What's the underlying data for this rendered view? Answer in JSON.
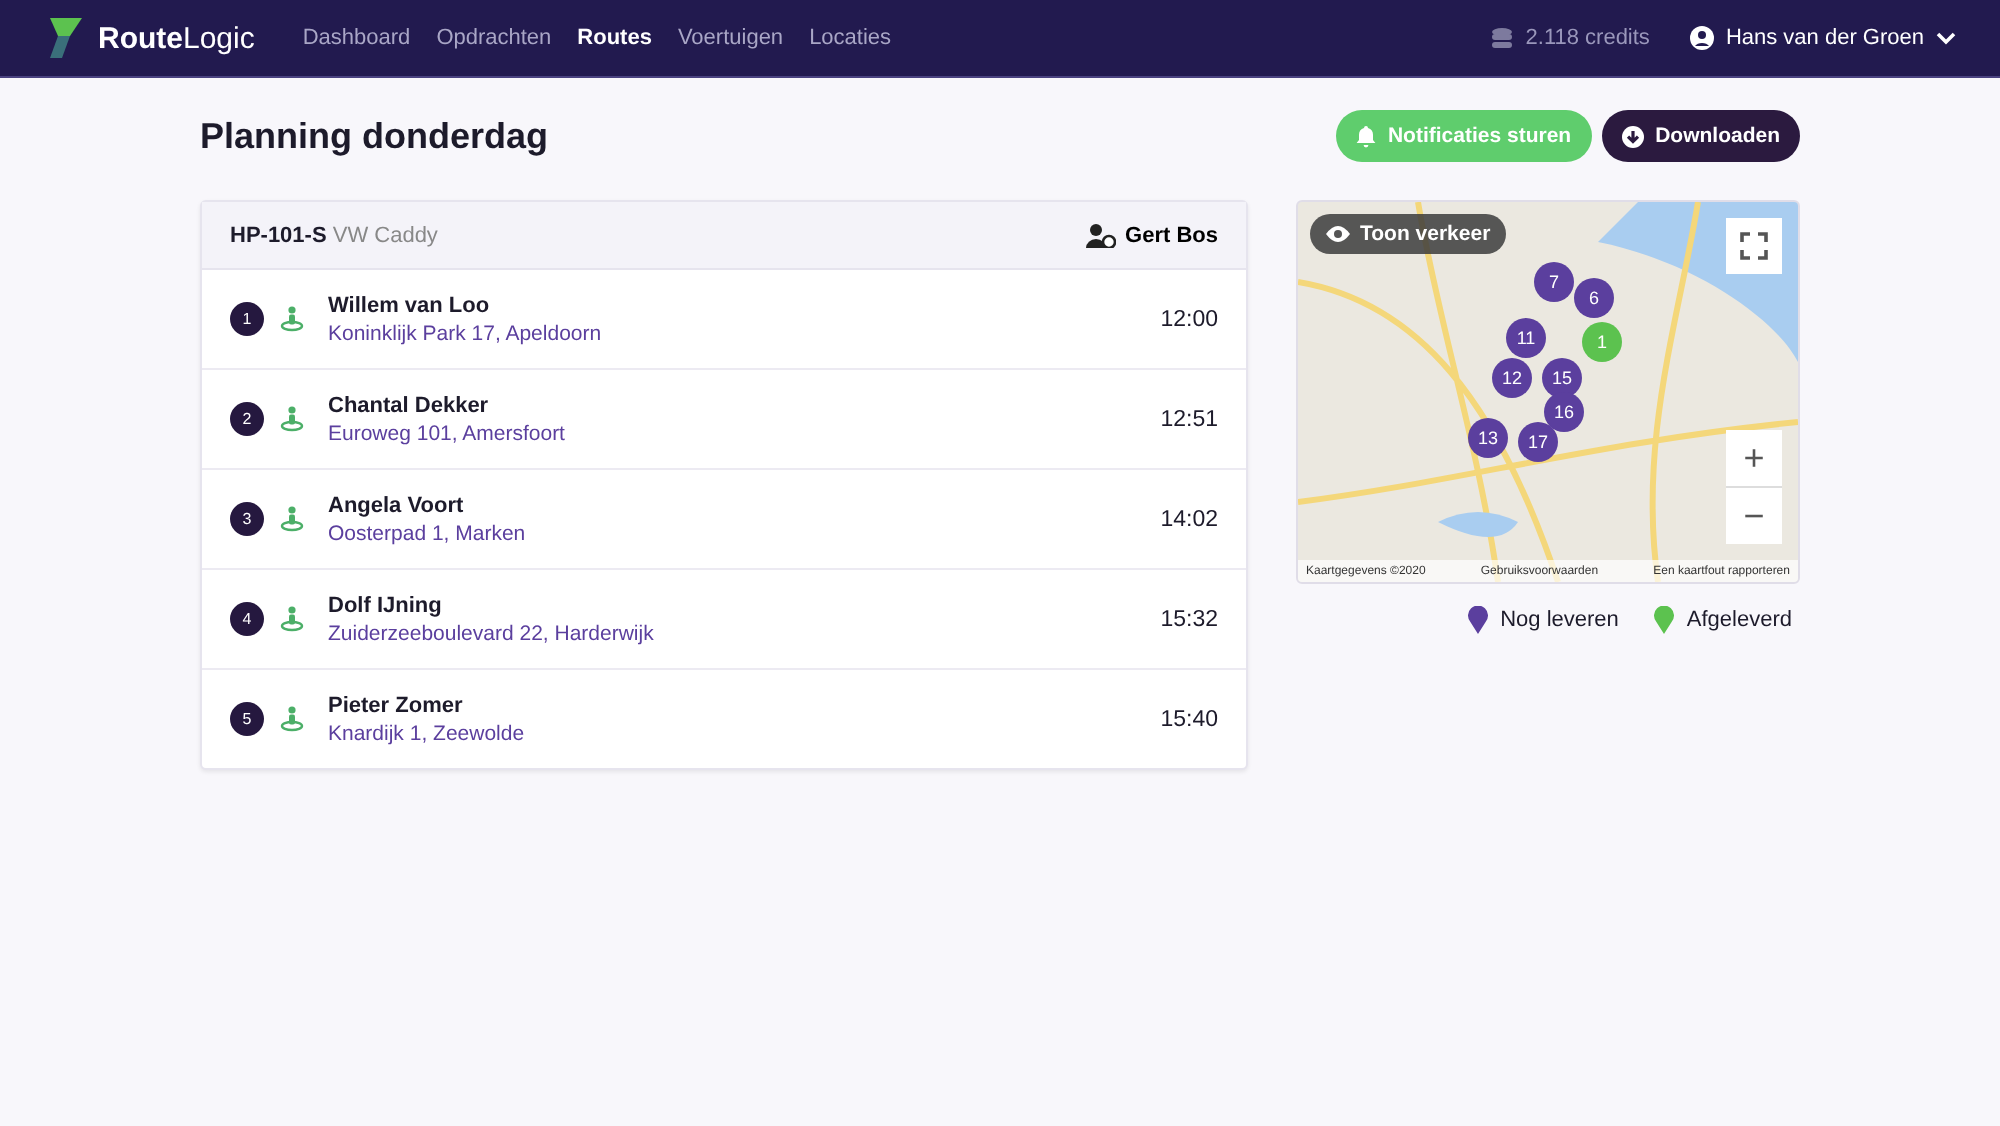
{
  "brand": {
    "name_bold": "Route",
    "name_light": "Logic"
  },
  "nav": [
    {
      "label": "Dashboard",
      "selected": false
    },
    {
      "label": "Opdrachten",
      "selected": false
    },
    {
      "label": "Routes",
      "selected": true
    },
    {
      "label": "Voertuigen",
      "selected": false
    },
    {
      "label": "Locaties",
      "selected": false
    }
  ],
  "credits": "2.118 credits",
  "user": "Hans van der Groen",
  "page_title": "Planning donderdag",
  "actions": [
    {
      "kind": "notify",
      "label": "Notificaties sturen"
    },
    {
      "kind": "download",
      "label": "Downloaden"
    }
  ],
  "route": {
    "plate": "HP-101-S",
    "vehicle": "VW Caddy",
    "driver": "Gert Bos"
  },
  "stops": [
    {
      "number": "1",
      "name": "Willem van Loo",
      "address": "Koninklijk Park 17, Apeldoorn",
      "time": "12:00"
    },
    {
      "number": "2",
      "name": "Chantal Dekker",
      "address": "Euroweg 101, Amersfoort",
      "time": "12:51"
    },
    {
      "number": "3",
      "name": "Angela Voort",
      "address": "Oosterpad 1, Marken",
      "time": "14:02"
    },
    {
      "number": "4",
      "name": "Dolf IJning",
      "address": "Zuiderzeeboulevard 22, Harderwijk",
      "time": "15:32"
    },
    {
      "number": "5",
      "name": "Pieter Zomer",
      "address": "Knardijk 1, Zeewolde",
      "time": "15:40"
    }
  ],
  "map": {
    "traffic_button": "Toon verkeer",
    "zoom_in": "+",
    "zoom_out": "−",
    "attribution": [
      "Kaartgegevens ©2020",
      "Gebruiksvoorwaarden",
      "Een kaartfout rapporteren"
    ],
    "markers": [
      {
        "label": "7",
        "color": "#5b3f9e"
      },
      {
        "label": "6",
        "color": "#5b3f9e"
      },
      {
        "label": "11",
        "color": "#5b3f9e"
      },
      {
        "label": "12",
        "color": "#5b3f9e"
      },
      {
        "label": "15",
        "color": "#5b3f9e"
      },
      {
        "label": "16",
        "color": "#5b3f9e"
      },
      {
        "label": "13",
        "color": "#5b3f9e"
      },
      {
        "label": "17",
        "color": "#5b3f9e"
      },
      {
        "label": "1",
        "color": "#5cc24f"
      }
    ]
  },
  "legend": [
    {
      "label": "Nog leveren",
      "color": "#5b3f9e"
    },
    {
      "label": "Afgeleverd",
      "color": "#5cc24f"
    }
  ]
}
